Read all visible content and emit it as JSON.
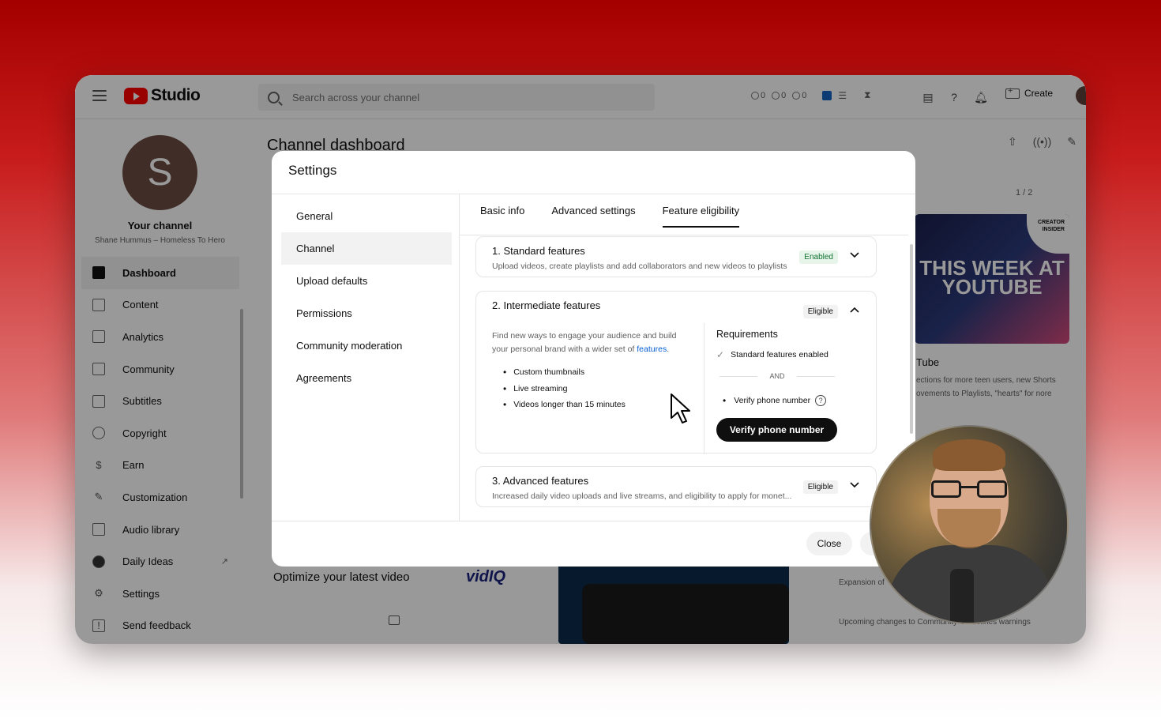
{
  "app": {
    "logo_text": "Studio",
    "search_placeholder": "Search across your channel",
    "stats": [
      "0",
      "0",
      "0"
    ],
    "create_label": "Create"
  },
  "sidebar": {
    "avatar_letter": "S",
    "your_channel": "Your channel",
    "channel_name": "Shane Hummus – Homeless To Hero",
    "items": [
      {
        "label": "Dashboard",
        "icon": "dashboard-icon",
        "active": true
      },
      {
        "label": "Content",
        "icon": "content-icon"
      },
      {
        "label": "Analytics",
        "icon": "analytics-icon"
      },
      {
        "label": "Community",
        "icon": "community-icon"
      },
      {
        "label": "Subtitles",
        "icon": "subtitles-icon"
      },
      {
        "label": "Copyright",
        "icon": "copyright-icon"
      },
      {
        "label": "Earn",
        "icon": "earn-icon"
      },
      {
        "label": "Customization",
        "icon": "customization-icon"
      },
      {
        "label": "Audio library",
        "icon": "audio-library-icon"
      },
      {
        "label": "Daily Ideas",
        "icon": "daily-ideas-icon"
      },
      {
        "label": "Settings",
        "icon": "settings-icon"
      },
      {
        "label": "Send feedback",
        "icon": "feedback-icon"
      }
    ]
  },
  "main": {
    "page_title": "Channel dashboard",
    "optimize_title": "Optimize your latest video",
    "vidiq_logo": "vidIQ",
    "pager": "1 / 2",
    "thumb_text": "THIS WEEK AT YOUTUBE",
    "thumb_badge": "CREATOR INSIDER",
    "news_title": "Tube",
    "news_desc": "ections for more teen users, new Shorts ovements to Playlists, \"hearts\" for nore",
    "news_2": "Expansion of",
    "news_3": "Upcoming changes to Community Guidelines warnings"
  },
  "dialog": {
    "title": "Settings",
    "nav": [
      "General",
      "Channel",
      "Upload defaults",
      "Permissions",
      "Community moderation",
      "Agreements"
    ],
    "active_nav": "Channel",
    "tabs": [
      "Basic info",
      "Advanced settings",
      "Feature eligibility"
    ],
    "active_tab": "Feature eligibility",
    "features": {
      "standard": {
        "title": "1. Standard features",
        "desc": "Upload videos, create playlists and add collaborators and new videos to playlists",
        "badge": "Enabled"
      },
      "intermediate": {
        "title": "2. Intermediate features",
        "badge": "Eligible",
        "desc_prefix": "Find new ways to engage your audience and build your personal brand with a wider set of ",
        "desc_link": "features",
        "desc_suffix": ".",
        "list": [
          "Custom thumbnails",
          "Live streaming",
          "Videos longer than 15 minutes"
        ],
        "requirements_title": "Requirements",
        "req_done": "Standard features enabled",
        "and_label": "AND",
        "req_todo": "Verify phone number",
        "verify_button": "Verify phone number"
      },
      "advanced": {
        "title": "3. Advanced features",
        "desc": "Increased daily video uploads and live streams, and eligibility to apply for monet...",
        "badge": "Eligible"
      }
    },
    "close_label": "Close"
  },
  "colors": {
    "brand_red": "#ff0000",
    "enabled_green": "#137333",
    "link_blue": "#065fd4"
  }
}
